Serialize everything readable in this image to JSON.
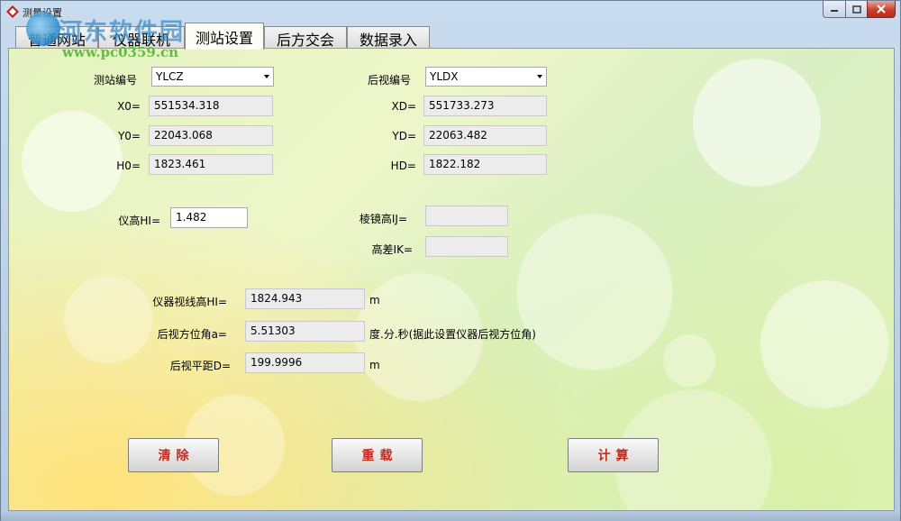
{
  "window": {
    "title": "测量设置"
  },
  "watermark": {
    "name": "河东软件园",
    "url": "www.pc0359.cn"
  },
  "tabs": [
    {
      "label": "普通网站",
      "active": false
    },
    {
      "label": "仪器联机",
      "active": false
    },
    {
      "label": "测站设置",
      "active": true
    },
    {
      "label": "后方交会",
      "active": false
    },
    {
      "label": "数据录入",
      "active": false
    }
  ],
  "station": {
    "id_label": "测站编号",
    "id_value": "YLCZ",
    "x0_label": "X0=",
    "x0_value": "551534.318",
    "y0_label": "Y0=",
    "y0_value": "22043.068",
    "h0_label": "H0=",
    "h0_value": "1823.461"
  },
  "backsight": {
    "id_label": "后视编号",
    "id_value": "YLDX",
    "xd_label": "XD=",
    "xd_value": "551733.273",
    "yd_label": "YD=",
    "yd_value": "22063.482",
    "hd_label": "HD=",
    "hd_value": "1822.182"
  },
  "heights": {
    "hi_label": "仪高HI=",
    "hi_value": "1.482",
    "prism_label": "棱镜高IJ=",
    "prism_value": "",
    "diff_label": "高差IK=",
    "diff_value": ""
  },
  "results": {
    "sight_height_label": "仪器视线高HI=",
    "sight_height_value": "1824.943",
    "sight_height_unit": "m",
    "azimuth_label": "后视方位角a=",
    "azimuth_value": "5.51303",
    "azimuth_unit": "度.分.秒(据此设置仪器后视方位角)",
    "distance_label": "后视平距D=",
    "distance_value": "199.9996",
    "distance_unit": "m"
  },
  "buttons": {
    "clear": "清除",
    "reload": "重载",
    "calculate": "计算"
  },
  "colors": {
    "button_text": "#c22a1e",
    "close_button": "#c9412e"
  }
}
